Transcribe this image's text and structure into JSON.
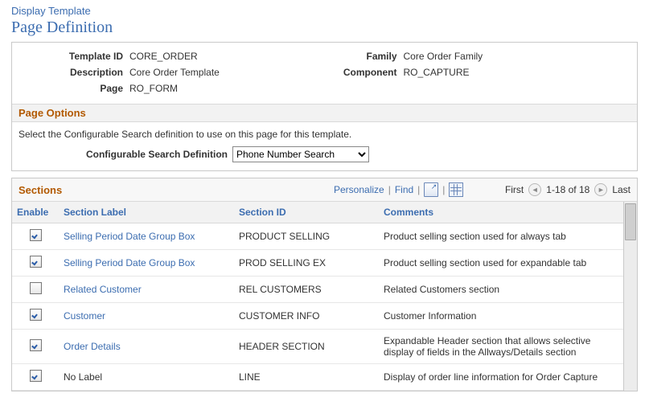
{
  "breadcrumb": "Display Template",
  "page_title": "Page Definition",
  "fields": {
    "template_id": {
      "label": "Template ID",
      "value": "CORE_ORDER"
    },
    "family": {
      "label": "Family",
      "value": "Core Order Family"
    },
    "description": {
      "label": "Description",
      "value": "Core Order Template"
    },
    "component": {
      "label": "Component",
      "value": "RO_CAPTURE"
    },
    "page": {
      "label": "Page",
      "value": "RO_FORM"
    }
  },
  "page_options": {
    "title": "Page Options",
    "instruction": "Select the Configurable Search definition to use on this page for this template.",
    "csd_label": "Configurable Search Definition",
    "csd_value": "Phone Number Search"
  },
  "sections": {
    "title": "Sections",
    "toolbar": {
      "personalize": "Personalize",
      "find": "Find",
      "first": "First",
      "range": "1-18 of 18",
      "last": "Last"
    },
    "columns": {
      "enable": "Enable",
      "label": "Section Label",
      "id": "Section ID",
      "comments": "Comments"
    },
    "rows": [
      {
        "enabled": true,
        "label": "Selling Period Date Group Box",
        "label_link": true,
        "id": "PRODUCT SELLING",
        "comments": "Product selling section used for always tab"
      },
      {
        "enabled": true,
        "label": "Selling Period Date Group Box",
        "label_link": true,
        "id": "PROD SELLING EX",
        "comments": "Product selling section used for expandable tab"
      },
      {
        "enabled": false,
        "label": "Related Customer",
        "label_link": true,
        "id": "REL CUSTOMERS",
        "comments": "Related Customers section"
      },
      {
        "enabled": true,
        "label": "Customer",
        "label_link": true,
        "id": "CUSTOMER INFO",
        "comments": "Customer Information"
      },
      {
        "enabled": true,
        "label": "Order Details",
        "label_link": true,
        "id": "HEADER SECTION",
        "comments": "Expandable Header section that allows selective display of fields in the Allways/Details section"
      },
      {
        "enabled": true,
        "label": "No Label",
        "label_link": false,
        "id": "LINE",
        "comments": "Display of order line information for Order Capture"
      }
    ]
  }
}
